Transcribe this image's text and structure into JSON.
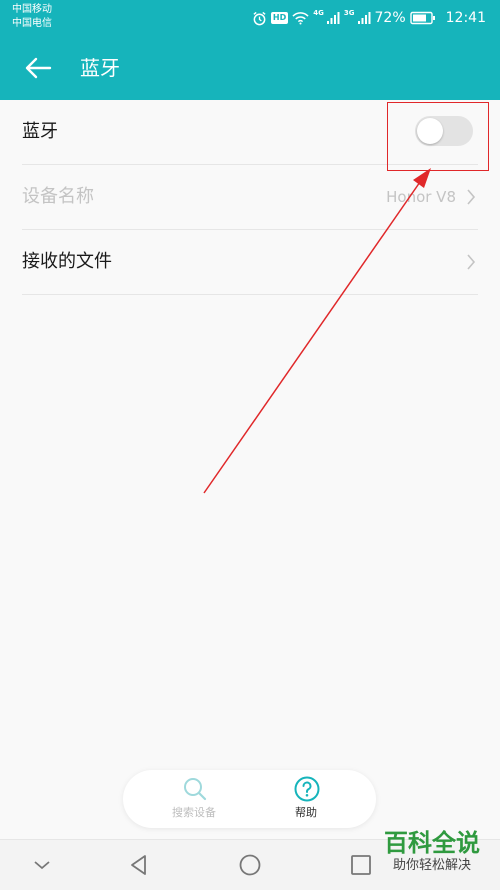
{
  "status_bar": {
    "carrier_1": "中国移动",
    "carrier_2": "中国电信",
    "hd_badge": "HD",
    "network_1": "4G",
    "network_2": "3G",
    "battery": "72%",
    "time": "12:41",
    "icons": [
      "alarm-icon",
      "hd-icon",
      "wifi-icon",
      "signal-icon",
      "signal-icon",
      "battery-icon"
    ]
  },
  "header": {
    "title": "蓝牙",
    "back_icon": "arrow-left-icon",
    "background": "#16b4bb"
  },
  "settings": {
    "bluetooth": {
      "label": "蓝牙",
      "enabled": false
    },
    "device_name": {
      "label": "设备名称",
      "value": "Honor V8",
      "disabled": true
    },
    "received_files": {
      "label": "接收的文件"
    }
  },
  "bottom_actions": {
    "search": {
      "label": "搜索设备",
      "icon": "search-icon",
      "disabled": true
    },
    "help": {
      "label": "帮助",
      "icon": "help-icon"
    }
  },
  "nav_bar": {
    "icons": [
      "chevron-down-icon",
      "back-triangle-icon",
      "home-circle-icon",
      "recents-square-icon"
    ]
  },
  "annotation": {
    "color": "#e0282a"
  },
  "watermark": {
    "title": "百科全说",
    "subtitle": "助你轻松解决"
  }
}
